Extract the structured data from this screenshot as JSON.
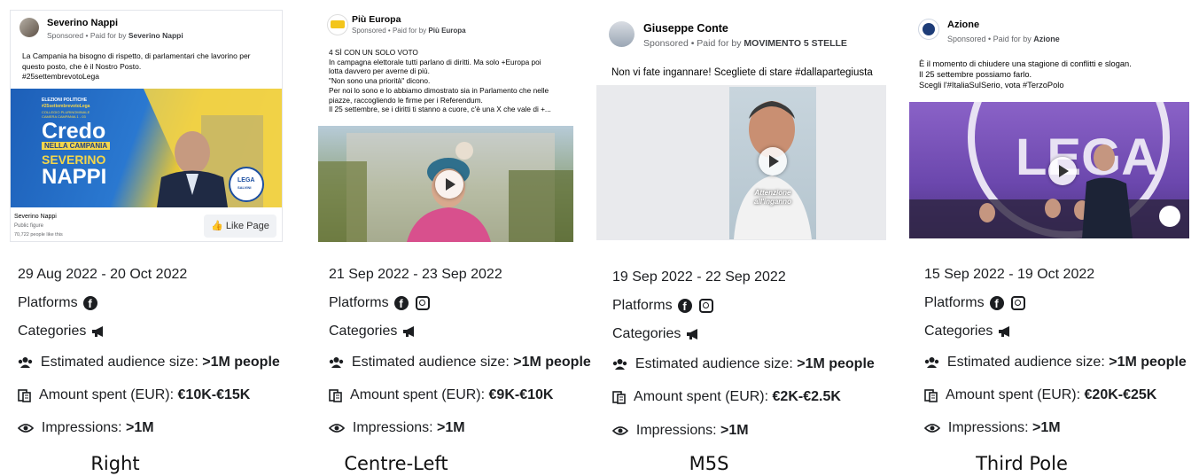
{
  "ads": [
    {
      "page_name": "Severino Nappi",
      "sponsored_prefix": "Sponsored • Paid for by ",
      "payer": "Severino Nappi",
      "body": "La Campania ha bisogno di rispetto, di parlamentari che lavorino per\nquesto posto, che è il Nostro Posto.\n#25settembrevotoLega",
      "creative": {
        "small_header": "ELEZIONI POLITICHE",
        "small_header2": "#25settembrevotoLega",
        "small_header3": "COLLEGIO PLURINOMINALE\nCAMERA CAMPANIA 1 - 03",
        "line1": "Credo",
        "line2": "NELLA CAMPANIA",
        "line3": "SEVERINO",
        "line4": "NAPPI",
        "logo": "LEGA",
        "logo_sub": "SALVINI"
      },
      "footer_name": "Severino Nappi",
      "footer_type": "Public figure",
      "footer_likes": "70,722 people like this",
      "like_button": "Like Page",
      "dates": "29 Aug 2022 - 20 Oct 2022",
      "platforms_label": "Platforms",
      "platforms": [
        "facebook"
      ],
      "categories_label": "Categories",
      "audience_label": "Estimated audience size: ",
      "audience_value": ">1M people",
      "spent_label": "Amount spent (EUR): ",
      "spent_value": "€10K-€15K",
      "impressions_label": "Impressions: ",
      "impressions_value": ">1M",
      "caption": "Right"
    },
    {
      "page_name": "Più Europa",
      "sponsored_prefix": "Sponsored • Paid for by ",
      "payer": "Più Europa",
      "body": "4 SÌ CON UN SOLO VOTO\nIn campagna elettorale tutti parlano di diritti. Ma solo +Europa poi\nlotta davvero per averne di più.\n\"Non sono una priorità\" dicono.\nPer noi lo sono e lo abbiamo dimostrato sia in Parlamento che nelle\npiazze, raccogliendo le firme per i Referendum.\nIl 25 settembre, se i diritti ti stanno a cuore, c'è una X che vale di +...",
      "dates": "21 Sep 2022 - 23 Sep 2022",
      "platforms_label": "Platforms",
      "platforms": [
        "facebook",
        "instagram"
      ],
      "categories_label": "Categories",
      "audience_label": "Estimated audience size: ",
      "audience_value": ">1M people",
      "spent_label": "Amount spent (EUR): ",
      "spent_value": "€9K-€10K",
      "impressions_label": "Impressions: ",
      "impressions_value": ">1M",
      "caption": "Centre-Left"
    },
    {
      "page_name": "Giuseppe Conte",
      "sponsored_prefix": "Sponsored • Paid for by ",
      "payer": "MOVIMENTO 5 STELLE",
      "body": "Non vi fate ingannare! Scegliete di stare #dallapartegiusta",
      "creative": {
        "overlay": "Attenzione\nall'inganno"
      },
      "dates": "19 Sep 2022 - 22 Sep 2022",
      "platforms_label": "Platforms",
      "platforms": [
        "facebook",
        "instagram"
      ],
      "categories_label": "Categories",
      "audience_label": "Estimated audience size: ",
      "audience_value": ">1M people",
      "spent_label": "Amount spent (EUR): ",
      "spent_value": "€2K-€2.5K",
      "impressions_label": "Impressions: ",
      "impressions_value": ">1M",
      "caption": "M5S"
    },
    {
      "page_name": "Azione",
      "sponsored_prefix": "Sponsored • Paid for by ",
      "payer": "Azione",
      "body": "È il momento di chiudere una stagione di conflitti e slogan.\nIl 25 settembre possiamo farlo.\nScegli l'#ItaliaSulSerio, vota #TerzoPolo",
      "creative": {
        "banner": "LEGA"
      },
      "dates": "15 Sep 2022 - 19 Oct 2022",
      "platforms_label": "Platforms",
      "platforms": [
        "facebook",
        "instagram"
      ],
      "categories_label": "Categories",
      "audience_label": "Estimated audience size: ",
      "audience_value": ">1M people",
      "spent_label": "Amount spent (EUR): ",
      "spent_value": "€20K-€25K",
      "impressions_label": "Impressions: ",
      "impressions_value": ">1M",
      "caption": "Third Pole"
    }
  ]
}
